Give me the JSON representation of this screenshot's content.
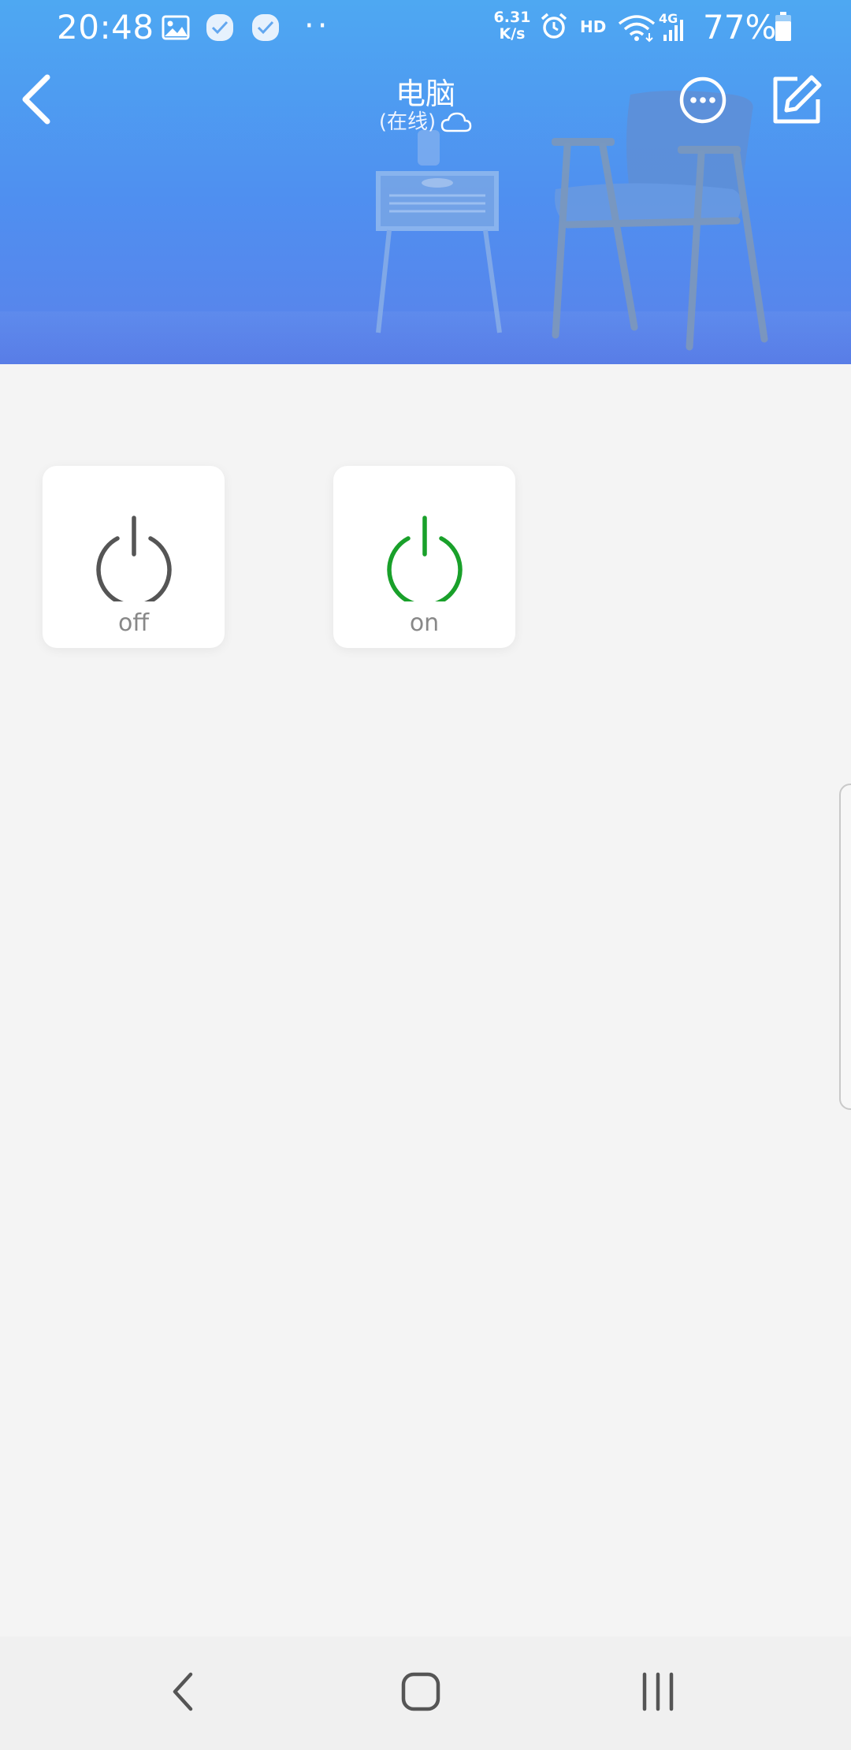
{
  "status_bar": {
    "time": "20:48",
    "net_speed_value": "6.31",
    "net_speed_unit": "K/s",
    "hd_label": "HD",
    "network_label": "4G",
    "battery": "77%",
    "more_notifications": "··",
    "icons": [
      "gallery-icon",
      "app-notification-icon",
      "app-notification-icon",
      "alarm-icon",
      "wifi-icon",
      "signal-icon",
      "battery-icon"
    ]
  },
  "header": {
    "title": "电脑",
    "subtitle": "(在线)",
    "back_icon": "chevron-left-icon",
    "more_icon": "more-options-icon",
    "edit_icon": "edit-icon",
    "cloud_icon": "cloud-icon"
  },
  "controls": [
    {
      "label": "off",
      "icon": "power-icon",
      "color": "#555555"
    },
    {
      "label": "on",
      "icon": "power-icon",
      "color": "#19a02a"
    }
  ],
  "system_nav": [
    "back-nav-icon",
    "home-nav-icon",
    "recents-nav-icon"
  ],
  "colors": {
    "header_top": "#4ea8f2",
    "header_bottom": "#5b82ea",
    "background": "#f4f4f4",
    "power_off": "#555555",
    "power_on": "#19a02a"
  }
}
